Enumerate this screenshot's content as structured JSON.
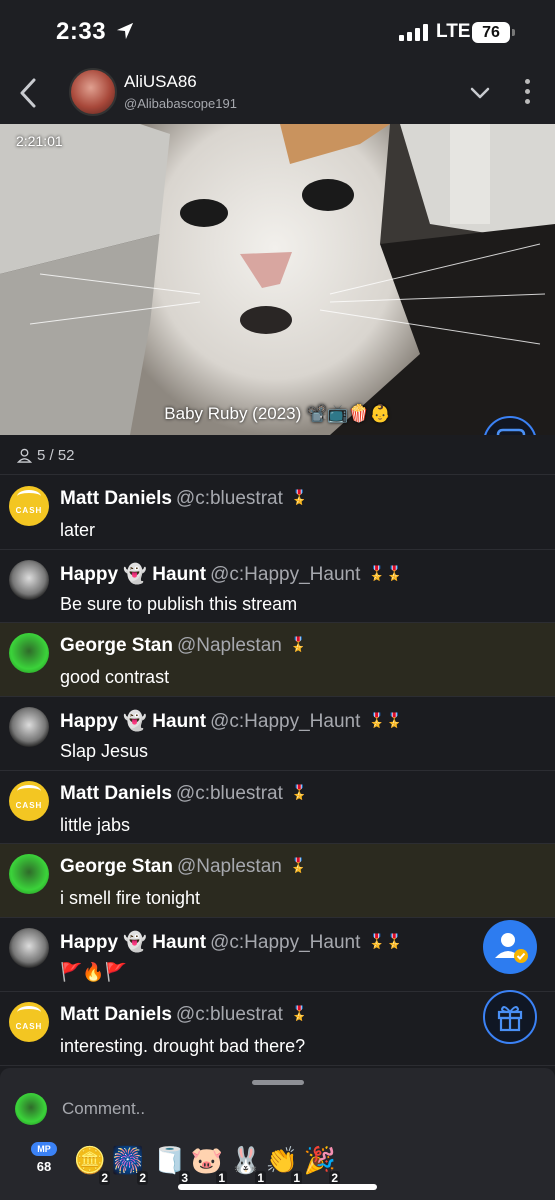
{
  "status_bar": {
    "time": "2:33",
    "network": "LTE",
    "battery": "76"
  },
  "header": {
    "host_name": "AliUSA86",
    "host_handle": "@Alibabascope191"
  },
  "video": {
    "timer": "2:21:01",
    "caption": "Baby Ruby (2023) 📽️📺🍿👶"
  },
  "viewers": {
    "count": "5 / 52"
  },
  "chat": [
    {
      "name": "Matt Daniels",
      "handle": "@c:bluestrat",
      "badge": "🎖️",
      "text": "later",
      "avatar": "cash",
      "highlight": false
    },
    {
      "name": "Happy 👻 Haunt",
      "handle": "@c:Happy_Haunt",
      "badge": "🎖️🎖️",
      "text": "Be sure to publish this stream",
      "avatar": "frank",
      "highlight": false
    },
    {
      "name": "George Stan",
      "handle": "@Naplestan",
      "badge": "🎖️",
      "text": "good contrast",
      "avatar": "green",
      "highlight": true
    },
    {
      "name": "Happy 👻 Haunt",
      "handle": "@c:Happy_Haunt",
      "badge": "🎖️🎖️",
      "text": "Slap Jesus",
      "avatar": "frank",
      "highlight": false
    },
    {
      "name": "Matt Daniels",
      "handle": "@c:bluestrat",
      "badge": "🎖️",
      "text": "little jabs",
      "avatar": "cash",
      "highlight": false
    },
    {
      "name": "George Stan",
      "handle": "@Naplestan",
      "badge": "🎖️",
      "text": "i smell fire tonight",
      "avatar": "green",
      "highlight": true
    },
    {
      "name": "Happy 👻 Haunt",
      "handle": "@c:Happy_Haunt",
      "badge": "🎖️🎖️",
      "text": "🚩🔥🚩",
      "avatar": "frank",
      "highlight": false
    },
    {
      "name": "Matt Daniels",
      "handle": "@c:bluestrat",
      "badge": "🎖️",
      "text": "interesting. drought bad there?",
      "avatar": "cash",
      "highlight": false
    }
  ],
  "comment": {
    "placeholder": "Comment.."
  },
  "points": {
    "label": "MP",
    "value": "68"
  },
  "gifts": [
    {
      "icon": "🪙",
      "count": "2"
    },
    {
      "icon": "🎆",
      "count": "2"
    },
    {
      "icon": "🧻",
      "count": "3"
    },
    {
      "icon": "🐷",
      "count": "1"
    },
    {
      "icon": "🐰",
      "count": "1"
    },
    {
      "icon": "👏",
      "count": "1"
    },
    {
      "icon": "🎉",
      "count": "2"
    }
  ],
  "colors": {
    "accent": "#3b82f6",
    "highlight_row": "#2b2a1f",
    "background": "#1b1c20"
  }
}
